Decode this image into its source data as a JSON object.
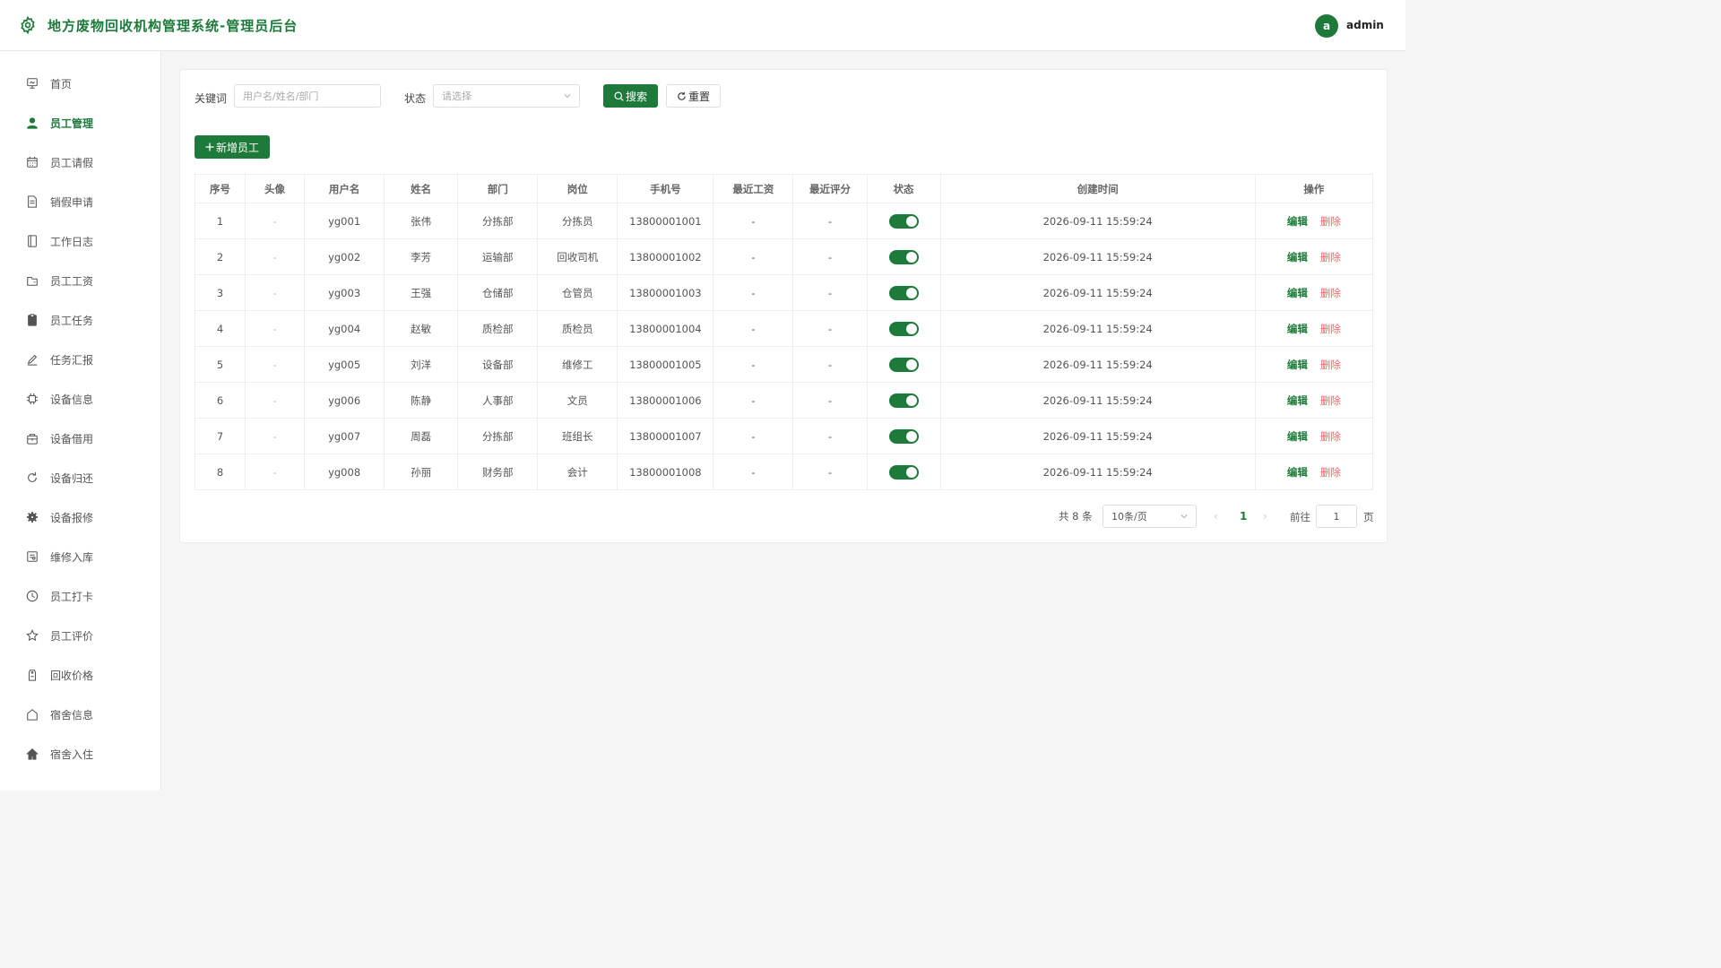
{
  "header": {
    "title": "地方废物回收机构管理系统-管理员后台",
    "avatar_letter": "a",
    "username": "admin"
  },
  "colors": {
    "primary": "#1e7a3a",
    "danger": "#f06060"
  },
  "sidebar": {
    "items": [
      {
        "label": "首页",
        "icon": "dashboard-icon"
      },
      {
        "label": "员工管理",
        "icon": "user-icon",
        "active": true
      },
      {
        "label": "员工请假",
        "icon": "calendar-icon"
      },
      {
        "label": "销假申请",
        "icon": "document-icon"
      },
      {
        "label": "工作日志",
        "icon": "notebook-icon"
      },
      {
        "label": "员工工资",
        "icon": "wallet-icon"
      },
      {
        "label": "员工任务",
        "icon": "clipboard-icon"
      },
      {
        "label": "任务汇报",
        "icon": "pen-icon"
      },
      {
        "label": "设备信息",
        "icon": "cpu-icon"
      },
      {
        "label": "设备借用",
        "icon": "bag-icon"
      },
      {
        "label": "设备归还",
        "icon": "refresh-icon"
      },
      {
        "label": "设备报修",
        "icon": "gear-icon"
      },
      {
        "label": "维修入库",
        "icon": "box-icon"
      },
      {
        "label": "员工打卡",
        "icon": "clock-icon"
      },
      {
        "label": "员工评价",
        "icon": "star-icon"
      },
      {
        "label": "回收价格",
        "icon": "tag-icon"
      },
      {
        "label": "宿舍信息",
        "icon": "house-icon"
      },
      {
        "label": "宿舍入住",
        "icon": "home-filled-icon"
      }
    ]
  },
  "filters": {
    "keyword_label": "关键词",
    "keyword_placeholder": "用户名/姓名/部门",
    "status_label": "状态",
    "status_placeholder": "请选择",
    "search_label": "搜索",
    "reset_label": "重置"
  },
  "add_button_label": "新增员工",
  "table": {
    "columns": [
      "序号",
      "头像",
      "用户名",
      "姓名",
      "部门",
      "岗位",
      "手机号",
      "最近工资",
      "最近评分",
      "状态",
      "创建时间",
      "操作"
    ],
    "edit_label": "编辑",
    "delete_label": "删除",
    "rows": [
      {
        "no": "1",
        "avatar": "-",
        "username": "yg001",
        "name": "张伟",
        "dept": "分拣部",
        "post": "分拣员",
        "phone": "13800001001",
        "salary": "-",
        "score": "-",
        "enabled": true,
        "created": "2026-09-11 15:59:24"
      },
      {
        "no": "2",
        "avatar": "-",
        "username": "yg002",
        "name": "李芳",
        "dept": "运输部",
        "post": "回收司机",
        "phone": "13800001002",
        "salary": "-",
        "score": "-",
        "enabled": true,
        "created": "2026-09-11 15:59:24"
      },
      {
        "no": "3",
        "avatar": "-",
        "username": "yg003",
        "name": "王强",
        "dept": "仓储部",
        "post": "仓管员",
        "phone": "13800001003",
        "salary": "-",
        "score": "-",
        "enabled": true,
        "created": "2026-09-11 15:59:24"
      },
      {
        "no": "4",
        "avatar": "-",
        "username": "yg004",
        "name": "赵敏",
        "dept": "质检部",
        "post": "质检员",
        "phone": "13800001004",
        "salary": "-",
        "score": "-",
        "enabled": true,
        "created": "2026-09-11 15:59:24"
      },
      {
        "no": "5",
        "avatar": "-",
        "username": "yg005",
        "name": "刘洋",
        "dept": "设备部",
        "post": "维修工",
        "phone": "13800001005",
        "salary": "-",
        "score": "-",
        "enabled": true,
        "created": "2026-09-11 15:59:24"
      },
      {
        "no": "6",
        "avatar": "-",
        "username": "yg006",
        "name": "陈静",
        "dept": "人事部",
        "post": "文员",
        "phone": "13800001006",
        "salary": "-",
        "score": "-",
        "enabled": true,
        "created": "2026-09-11 15:59:24"
      },
      {
        "no": "7",
        "avatar": "-",
        "username": "yg007",
        "name": "周磊",
        "dept": "分拣部",
        "post": "班组长",
        "phone": "13800001007",
        "salary": "-",
        "score": "-",
        "enabled": true,
        "created": "2026-09-11 15:59:24"
      },
      {
        "no": "8",
        "avatar": "-",
        "username": "yg008",
        "name": "孙丽",
        "dept": "财务部",
        "post": "会计",
        "phone": "13800001008",
        "salary": "-",
        "score": "-",
        "enabled": true,
        "created": "2026-09-11 15:59:24"
      }
    ]
  },
  "pagination": {
    "total_text": "共 8 条",
    "page_size": "10条/页",
    "current_page": "1",
    "goto_label": "前往",
    "goto_value": "1",
    "page_suffix": "页"
  }
}
